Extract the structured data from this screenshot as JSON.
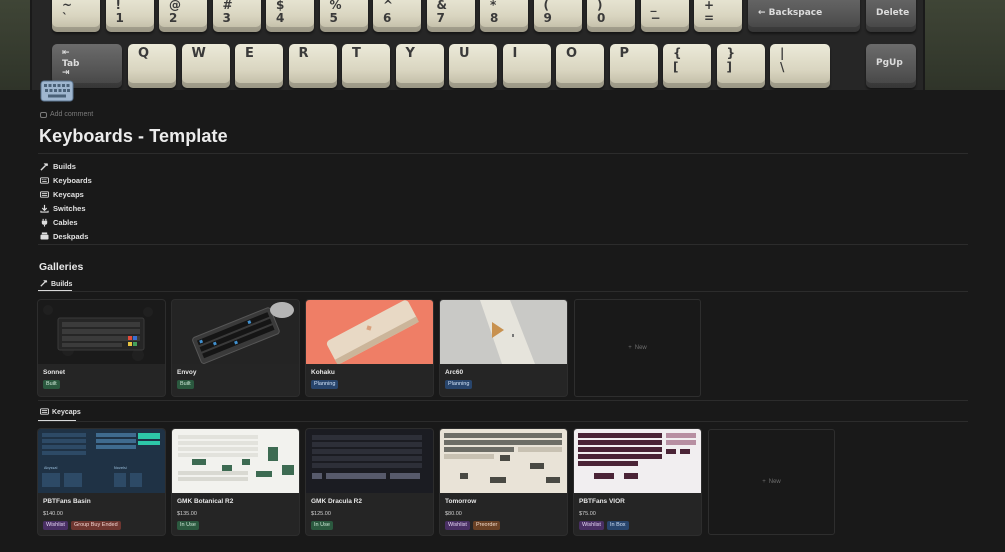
{
  "cover": {
    "keys_row1": [
      {
        "top": "~",
        "bot": "`"
      },
      {
        "top": "!",
        "bot": "1"
      },
      {
        "top": "@",
        "bot": "2"
      },
      {
        "top": "#",
        "bot": "3"
      },
      {
        "top": "$",
        "bot": "4"
      },
      {
        "top": "%",
        "bot": "5"
      },
      {
        "top": "^",
        "bot": "6"
      },
      {
        "top": "&",
        "bot": "7"
      },
      {
        "top": "*",
        "bot": "8"
      },
      {
        "top": "(",
        "bot": "9"
      },
      {
        "top": ")",
        "bot": "0"
      },
      {
        "top": "_",
        "bot": "−"
      },
      {
        "top": "+",
        "bot": "="
      }
    ],
    "backspace_label": "← Backspace",
    "delete_label": "Delete",
    "tab_label": "Tab",
    "keys_row2": [
      "Q",
      "W",
      "E",
      "R",
      "T",
      "Y",
      "U",
      "I",
      "O",
      "P"
    ],
    "bracket_keys": [
      {
        "top": "{",
        "bot": "["
      },
      {
        "top": "}",
        "bot": "]"
      },
      {
        "top": "|",
        "bot": "\\"
      }
    ],
    "pgup_label": "PgUp"
  },
  "header": {
    "add_comment": "Add comment",
    "title": "Keyboards - Template"
  },
  "links": [
    {
      "icon": "hammer-icon",
      "label": "Builds"
    },
    {
      "icon": "keyboard-icon",
      "label": "Keyboards"
    },
    {
      "icon": "keycaps-icon",
      "label": "Keycaps"
    },
    {
      "icon": "download-icon",
      "label": "Switches"
    },
    {
      "icon": "plug-icon",
      "label": "Cables"
    },
    {
      "icon": "deskpad-icon",
      "label": "Deskpads"
    }
  ],
  "galleries": {
    "title": "Galleries",
    "builds": {
      "tab_label": "Builds",
      "cards": [
        {
          "name": "Sonnet",
          "tags": [
            "Built"
          ]
        },
        {
          "name": "Envoy",
          "tags": [
            "Built"
          ]
        },
        {
          "name": "Kohaku",
          "tags": [
            "Planning"
          ]
        },
        {
          "name": "Arc60",
          "tags": [
            "Planning"
          ]
        }
      ],
      "new_label": "New"
    },
    "keycaps": {
      "tab_label": "Keycaps",
      "cards": [
        {
          "name": "PBTFans Basin",
          "price": "$140.00",
          "tags": [
            "Wishlist",
            "Group Buy Ended"
          ]
        },
        {
          "name": "GMK Botanical R2",
          "price": "$135.00",
          "tags": [
            "In Use"
          ]
        },
        {
          "name": "GMK Dracula R2",
          "price": "$125.00",
          "tags": [
            "In Use"
          ]
        },
        {
          "name": "Tomorrow",
          "price": "$80.00",
          "tags": [
            "Wishlist",
            "Preorder"
          ]
        },
        {
          "name": "PBTFans VIOR",
          "price": "$75.00",
          "tags": [
            "Wishlist",
            "In Box"
          ]
        }
      ],
      "new_label": "New"
    }
  },
  "colors": {
    "background": "#191919",
    "card": "#252525",
    "tag_green": "#2b593f",
    "tag_blue": "#28456c",
    "tag_purple": "#492f64",
    "tag_red": "#6e3630",
    "tag_orange": "#694125"
  }
}
